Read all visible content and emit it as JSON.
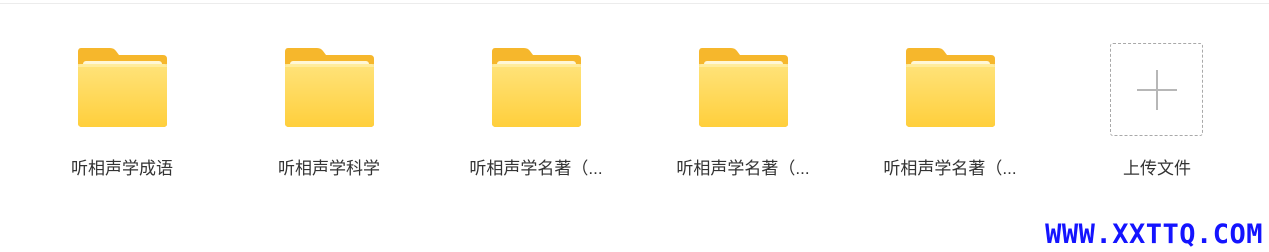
{
  "folders": [
    {
      "label": "听相声学成语"
    },
    {
      "label": "听相声学科学"
    },
    {
      "label": "听相声学名著（..."
    },
    {
      "label": "听相声学名著（..."
    },
    {
      "label": "听相声学名著（..."
    }
  ],
  "upload": {
    "label": "上传文件",
    "icon": "plus-icon"
  },
  "folder_icon": "folder-icon",
  "colors": {
    "folder_back": "#F6B72C",
    "folder_front_top": "#FFE37A",
    "folder_front_bottom": "#FFCF3C",
    "folder_paper": "#FFF7D6",
    "label_text": "#333333",
    "upload_border": "#A9A9A9",
    "plus": "#B7B7B7",
    "watermark": "#1414FF"
  },
  "watermark": {
    "text": "WWW.XXTTQ.COM"
  }
}
